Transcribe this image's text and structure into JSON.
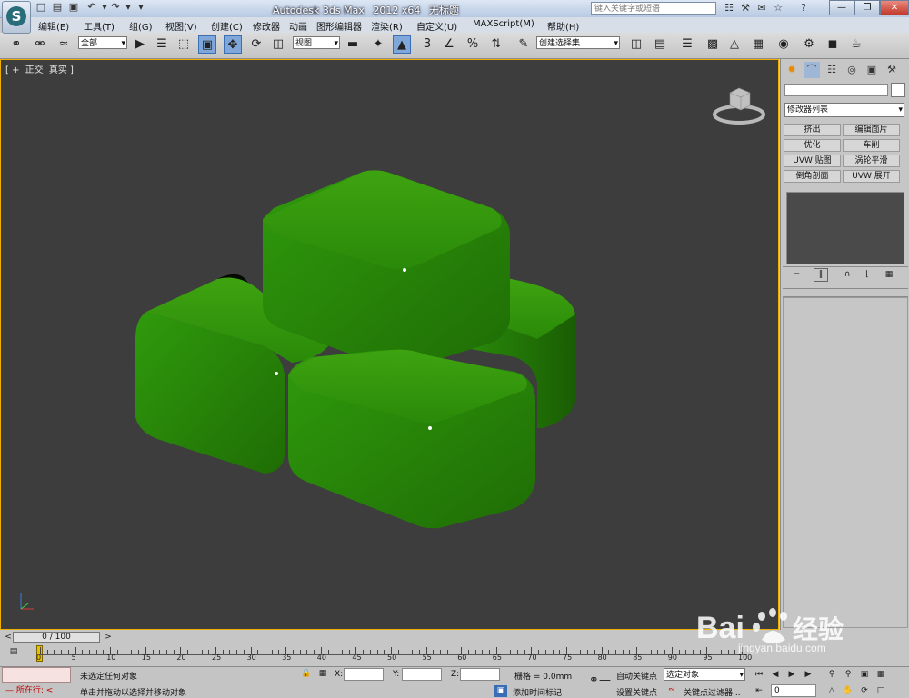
{
  "app": {
    "logo_glyph": "S"
  },
  "titlebar": {
    "app_name": "Autodesk 3ds Max",
    "version": "2012 x64",
    "doc_name": "无标题",
    "search_placeholder": "键入关键字或短语"
  },
  "menu": [
    "编辑(E)",
    "工具(T)",
    "组(G)",
    "视图(V)",
    "创建(C)",
    "修改器",
    "动画",
    "图形编辑器",
    "渲染(R)",
    "自定义(U)",
    "MAXScript(M)",
    "帮助(H)"
  ],
  "toolbar": {
    "selection_filter": "全部",
    "ref_coord": "视图",
    "named_selection": "创建选择集",
    "snap_labels": [
      "3",
      "%"
    ]
  },
  "viewport": {
    "labels": [
      "[ +",
      "正交",
      "真实 ]"
    ],
    "colors": {
      "background": "#3d3d3d",
      "border": "#f0b000",
      "objects": "#2f8f0c"
    }
  },
  "command_panel": {
    "modifier_list": "修改器列表",
    "modifier_buttons": [
      "挤出",
      "编辑面片",
      "优化",
      "车削",
      "UVW 贴图",
      "涡轮平滑",
      "倒角剖面",
      "UVW 展开"
    ]
  },
  "timeline": {
    "slider_text": "0 / 100",
    "ticks": [
      "0",
      "5",
      "10",
      "15",
      "20",
      "25",
      "30",
      "35",
      "40",
      "45",
      "50",
      "55",
      "60",
      "65",
      "70",
      "75",
      "80",
      "85",
      "90",
      "95",
      "100"
    ]
  },
  "status": {
    "running_label": "所在行:",
    "selection_status": "未选定任何对象",
    "prompt": "单击并拖动以选择并移动对象",
    "x_label": "X:",
    "y_label": "Y:",
    "z_label": "Z:",
    "grid": "栅格 = 0.0mm",
    "add_tag": "添加时间标记",
    "auto_key": "自动关键点",
    "set_key": "设置关键点",
    "key_mode": "选定对象",
    "key_filter": "关键点过滤器...",
    "frame": "0"
  },
  "watermark": {
    "text": "Bai",
    "suffix": "经验",
    "url": "jingyan.baidu.com"
  }
}
